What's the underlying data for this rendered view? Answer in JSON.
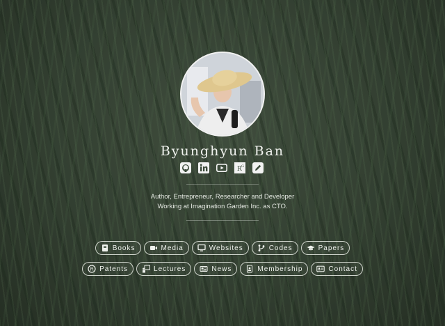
{
  "profile": {
    "name": "Byunghyun Ban",
    "bio_line1": "Author, Entrepreneur, Researcher and Developer",
    "bio_line2": "Working at Imagination Garden Inc. as CTO."
  },
  "social": [
    {
      "icon": "github-icon"
    },
    {
      "icon": "linkedin-icon"
    },
    {
      "icon": "youtube-icon"
    },
    {
      "icon": "researchgate-icon",
      "text": "R"
    },
    {
      "icon": "pencil-icon"
    }
  ],
  "nav_row1": [
    {
      "label": "Books",
      "icon": "book-icon"
    },
    {
      "label": "Media",
      "icon": "video-camera-icon"
    },
    {
      "label": "Websites",
      "icon": "monitor-icon"
    },
    {
      "label": "Codes",
      "icon": "code-branch-icon"
    },
    {
      "label": "Papers",
      "icon": "graduation-cap-icon"
    }
  ],
  "nav_row2": [
    {
      "label": "Patents",
      "icon": "registered-icon"
    },
    {
      "label": "Lectures",
      "icon": "teacher-icon"
    },
    {
      "label": "News",
      "icon": "newspaper-icon"
    },
    {
      "label": "Membership",
      "icon": "id-badge-icon"
    },
    {
      "label": "Contact",
      "icon": "address-card-icon"
    }
  ],
  "colors": {
    "text": "#eef1ec",
    "background": "#3b4a3a"
  }
}
